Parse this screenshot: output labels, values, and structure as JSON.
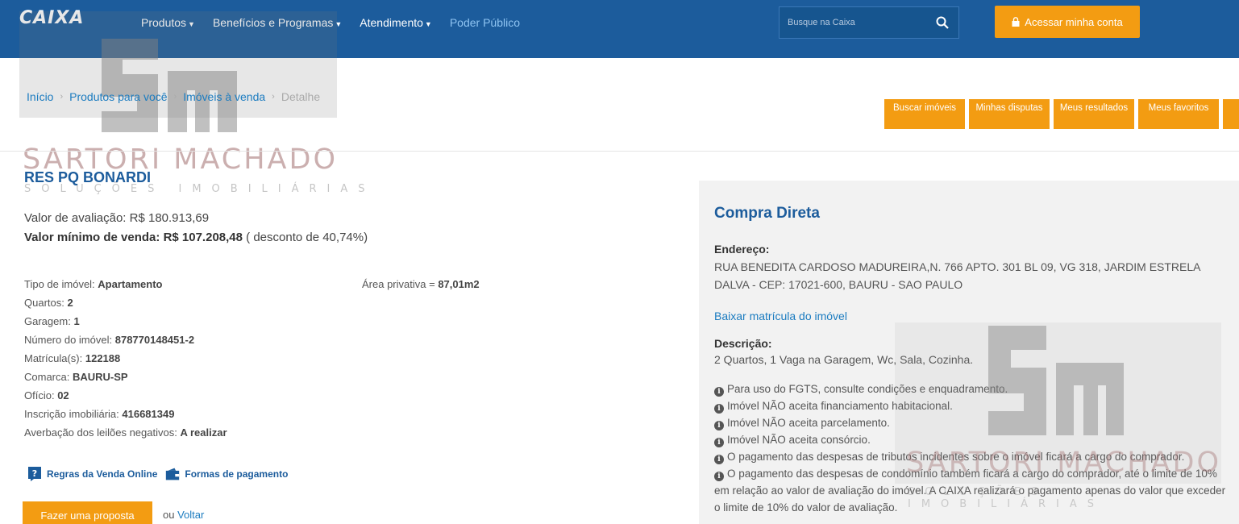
{
  "header": {
    "logo": "CAIXA",
    "nav": [
      {
        "label": "Produtos",
        "caret": true
      },
      {
        "label": "Benefícios e Programas",
        "caret": true
      },
      {
        "label": "Atendimento",
        "caret": true
      },
      {
        "label": "Poder Público",
        "caret": false
      }
    ],
    "search_placeholder": "Busque na Caixa",
    "login_label": "Acessar minha conta"
  },
  "breadcrumb": [
    "Início",
    "Produtos para você",
    "Imóveis à venda",
    "Detalhe"
  ],
  "quick_buttons": [
    "Buscar imóveis",
    "Minhas disputas",
    "Meus resultados",
    "Meus favoritos"
  ],
  "watermark": {
    "brand": "SARTORI MACHADO",
    "tagline": "SOLUÇÕES IMOBILIÁRIAS"
  },
  "property": {
    "title": "RES PQ BONARDI",
    "valor_avaliacao_label": "Valor de avaliação:",
    "valor_avaliacao": "R$ 180.913,69",
    "valor_minimo_label": "Valor mínimo de venda:",
    "valor_minimo": "R$ 107.208,48",
    "desconto": "( desconto de 40,74%)",
    "details": [
      {
        "label": "Tipo de imóvel:",
        "value": "Apartamento"
      },
      {
        "label": "Quartos:",
        "value": "2"
      },
      {
        "label": "Garagem:",
        "value": "1"
      },
      {
        "label": "Número do imóvel:",
        "value": "878770148451-2"
      },
      {
        "label": "Matrícula(s):",
        "value": "122188"
      },
      {
        "label": "Comarca:",
        "value": "BAURU-SP"
      },
      {
        "label": "Ofício:",
        "value": "02"
      },
      {
        "label": "Inscrição imobiliária:",
        "value": "416681349"
      },
      {
        "label": "Averbação dos leilões negativos:",
        "value": "A realizar"
      }
    ],
    "area_label": "Área privativa =",
    "area_value": "87,01m2",
    "link_regras": "Regras da Venda Online",
    "link_pagamento": "Formas de pagamento",
    "proposal_button": "Fazer uma proposta",
    "ou": "ou",
    "voltar": "Voltar"
  },
  "panel": {
    "title": "Compra Direta",
    "endereco_label": "Endereço:",
    "endereco": "RUA BENEDITA CARDOSO MADUREIRA,N. 766 APTO. 301 BL 09, VG 318, JARDIM ESTRELA DALVA - CEP: 17021-600, BAURU - SAO PAULO",
    "baixar": "Baixar matrícula do imóvel",
    "descricao_label": "Descrição:",
    "descricao": "2 Quartos, 1 Vaga na Garagem, Wc, Sala, Cozinha.",
    "notes": [
      "Para uso do FGTS, consulte condições e enquadramento.",
      "Imóvel NÃO aceita financiamento habitacional.",
      "Imóvel NÃO aceita parcelamento.",
      "Imóvel NÃO aceita consórcio.",
      "O pagamento das despesas de tributos incidentes sobre o imóvel ficará a cargo do comprador.",
      "O pagamento das despesas de condomínio também ficará a cargo do comprador, até o limite de 10% em relação ao valor de avaliação do imóvel. A CAIXA realizará o pagamento apenas do valor que exceder o limite de 10% do valor de avaliação."
    ]
  },
  "colors": {
    "header_blue": "#1c5c9c",
    "accent_orange": "#f39c12",
    "link_blue": "#1c7cc0",
    "panel_gray": "#f2f2f2"
  }
}
